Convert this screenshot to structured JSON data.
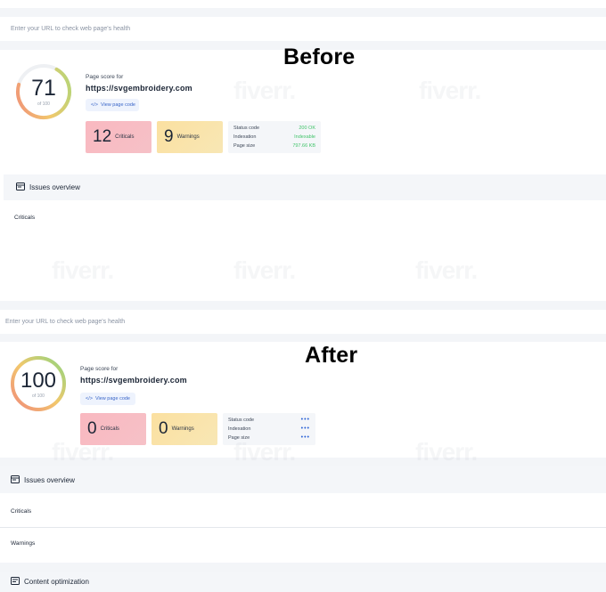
{
  "before": {
    "heading": "Before",
    "url_placeholder": "Enter your URL to check web page's health",
    "score": {
      "value": "71",
      "of": "of 100",
      "fraction": 0.71
    },
    "score_label": "Page score for",
    "site": "https://svgembroidery.com",
    "view_code": "View page code",
    "criticals": {
      "count": "12",
      "label": "Criticals"
    },
    "warnings": {
      "count": "9",
      "label": "Warnings"
    },
    "info": [
      {
        "label": "Status code",
        "value": "200 OK"
      },
      {
        "label": "Indexation",
        "value": "Indexable"
      },
      {
        "label": "Page size",
        "value": "797.66 KB"
      }
    ],
    "issues_title": "Issues overview",
    "criticals_row": "Criticals"
  },
  "after": {
    "heading": "After",
    "url_placeholder": "Enter your URL to check web page's health",
    "score": {
      "value": "100",
      "of": "of 100",
      "fraction": 1.0
    },
    "score_label": "Page score for",
    "site": "https://svgembroidery.com",
    "view_code": "View page code",
    "criticals": {
      "count": "0",
      "label": "Criticals"
    },
    "warnings": {
      "count": "0",
      "label": "Warnings"
    },
    "info": [
      {
        "label": "Status code",
        "value": "•••"
      },
      {
        "label": "Indexation",
        "value": "•••"
      },
      {
        "label": "Page size",
        "value": "•••"
      }
    ],
    "issues_title": "Issues overview",
    "criticals_row": "Criticals",
    "warnings_row": "Warnings",
    "content_title": "Content optimization"
  },
  "watermark": "fiverr.",
  "colors": {
    "accent": "#3a66c8",
    "ok": "#43c46b",
    "critical": "#f9b8c0",
    "warning": "#fbe0a0"
  }
}
